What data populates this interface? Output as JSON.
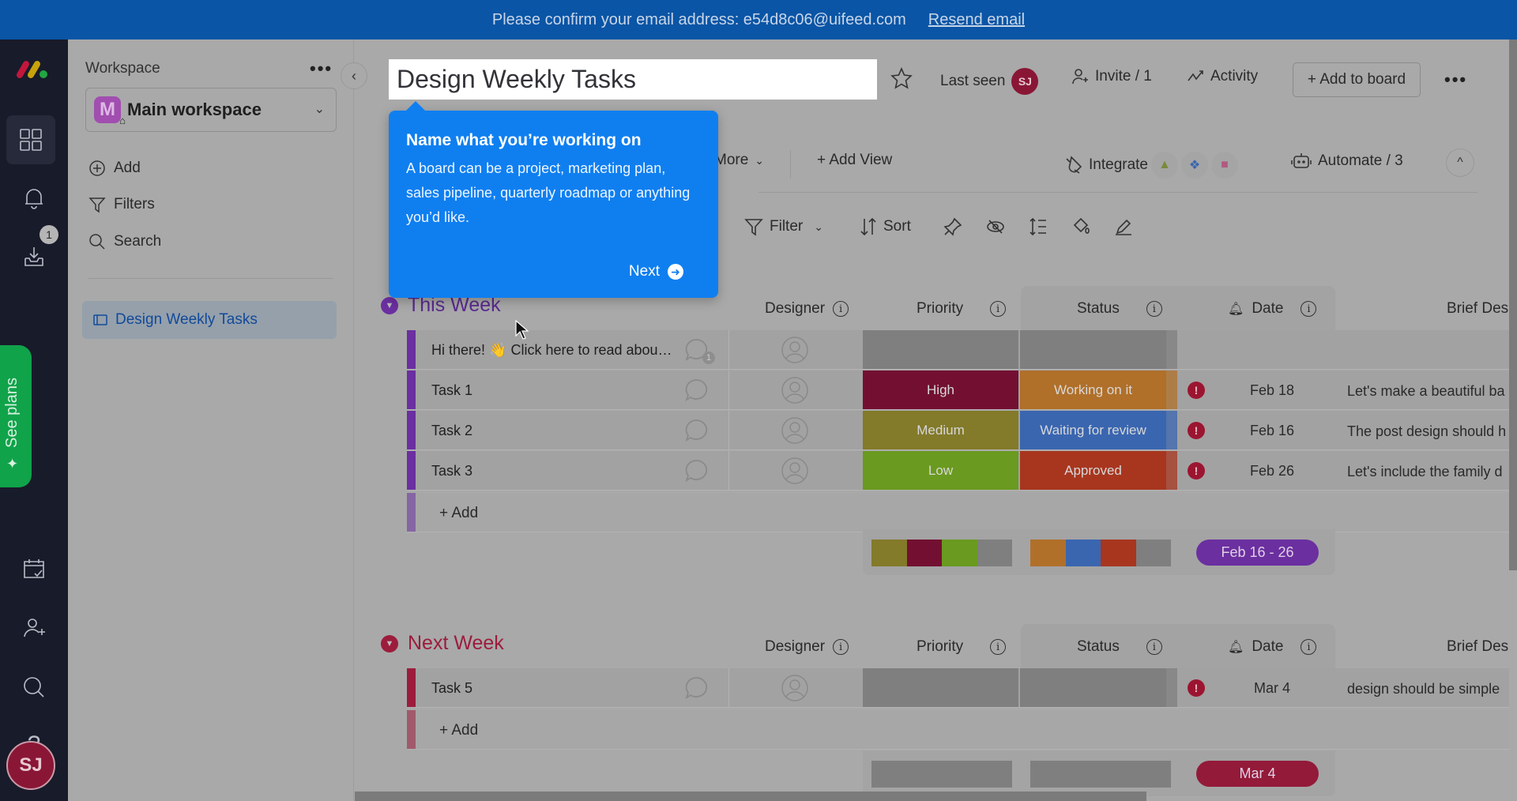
{
  "banner": {
    "message": "Please confirm your email address: e54d8c06@uifeed.com",
    "resend_link": "Resend email"
  },
  "rail": {
    "notifications_badge": "1",
    "see_plans": "See plans",
    "avatar_initials": "SJ"
  },
  "workspace": {
    "label": "Workspace",
    "avatar_letter": "M",
    "name": "Main workspace",
    "actions": [
      {
        "label": "Add",
        "icon": "plus-circle-icon"
      },
      {
        "label": "Filters",
        "icon": "filter-icon"
      },
      {
        "label": "Search",
        "icon": "search-icon"
      }
    ],
    "boards": [
      {
        "label": "Design Weekly Tasks",
        "active": true
      }
    ]
  },
  "header": {
    "title": "Design Weekly Tasks",
    "last_seen_label": "Last seen",
    "last_seen_initials": "SJ",
    "invite_label": "Invite / 1",
    "activity_label": "Activity",
    "add_to_board_label": "+ Add to board"
  },
  "views": {
    "more_label": "More",
    "add_view_label": "+ Add View",
    "integrate_label": "Integrate",
    "integrations": [
      "google-drive-icon",
      "dropbox-icon",
      "app-icon"
    ],
    "automate_label": "Automate / 3"
  },
  "toolbar": {
    "filter_label": "Filter",
    "sort_label": "Sort"
  },
  "tooltip": {
    "title": "Name what you’re working on",
    "body": "A board can be a project, marketing plan, sales pipeline, quarterly roadmap or anything you’d like.",
    "next_label": "Next"
  },
  "columns": {
    "designer": "Designer",
    "priority": "Priority",
    "status": "Status",
    "date": "Date",
    "brief": "Brief Des"
  },
  "groups": [
    {
      "title": "This Week",
      "color": "#6b2fa0",
      "rows": [
        {
          "name": "Hi there! 👋 Click here to read abou…",
          "comments": "1",
          "priority": "",
          "priority_color": "#7f7f7f",
          "status": "",
          "status_color": "#7f7f7f",
          "overdue": false,
          "date": "",
          "brief": ""
        },
        {
          "name": "Task 1",
          "comments": "",
          "priority": "High",
          "priority_color": "#731032",
          "status": "Working on it",
          "status_color": "#b0702a",
          "overdue": true,
          "date": "Feb 18",
          "brief": "Let's make a beautiful ba"
        },
        {
          "name": "Task 2",
          "comments": "",
          "priority": "Medium",
          "priority_color": "#837a2a",
          "status": "Waiting for review",
          "status_color": "#3a66b0",
          "overdue": true,
          "date": "Feb 16",
          "brief": "The post design should h"
        },
        {
          "name": "Task 3",
          "comments": "",
          "priority": "Low",
          "priority_color": "#6a9a20",
          "status": "Approved",
          "status_color": "#a8361f",
          "overdue": true,
          "date": "Feb 26",
          "brief": "Let's include the family d"
        }
      ],
      "add_label": "+ Add",
      "priority_summary": [
        "#837a2a",
        "#731032",
        "#6a9a20",
        "#7f7f7f"
      ],
      "status_summary": [
        "#b0702a",
        "#3a66b0",
        "#a8361f",
        "#7f7f7f"
      ],
      "date_range": "Feb 16 - 26",
      "date_range_color": "#6b2fa0"
    },
    {
      "title": "Next Week",
      "color": "#9c1c3c",
      "rows": [
        {
          "name": "Task 5",
          "comments": "",
          "priority": "",
          "priority_color": "#7f7f7f",
          "status": "",
          "status_color": "#7f7f7f",
          "overdue": true,
          "date": "Mar 4",
          "brief": "design should be simple"
        }
      ],
      "add_label": "+ Add",
      "priority_summary": [
        "#7f7f7f"
      ],
      "status_summary": [
        "#7f7f7f"
      ],
      "date_range": "Mar 4",
      "date_range_color": "#931a38"
    }
  ]
}
